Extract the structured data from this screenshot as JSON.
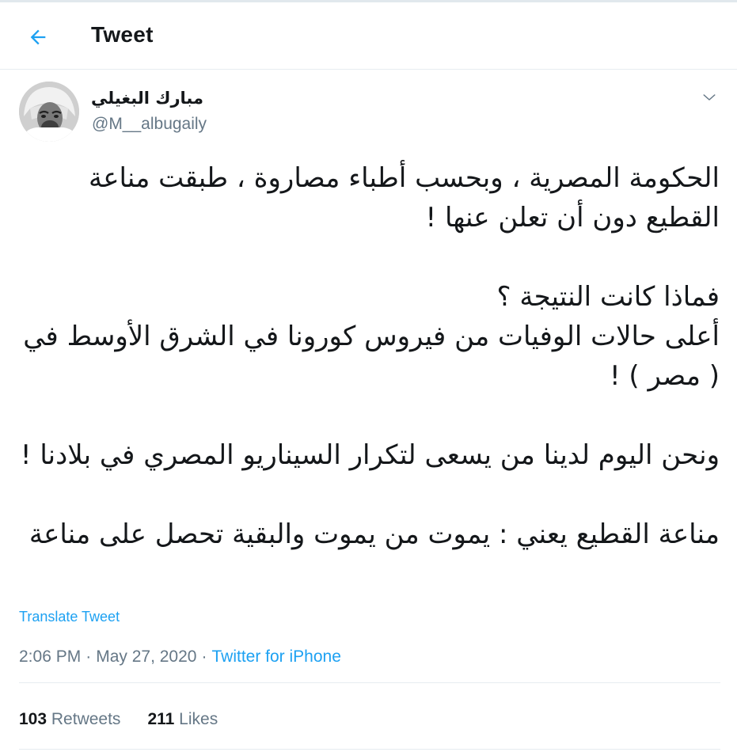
{
  "header": {
    "back_icon": "arrow-left-icon",
    "title": "Tweet",
    "accent_color": "#1da1f2"
  },
  "author": {
    "name": "مبارك البغيلي",
    "handle": "@M__albugaily",
    "avatar_icon": "user-avatar",
    "more_icon": "chevron-down-icon"
  },
  "tweet": {
    "paragraphs": [
      "الحكومة المصرية ، وبحسب أطباء مصاروة ، طبقت مناعة القطيع دون أن تعلن عنها !",
      "فماذا كانت النتيجة ؟\nأعلى حالات الوفيات من فيروس كورونا في الشرق الأوسط في ( مصر ) !",
      "ونحن اليوم لدينا من يسعى لتكرار السيناريو المصري في بلادنا !",
      "مناعة القطيع يعني : يموت من يموت والبقية تحصل على مناعة"
    ],
    "translate_label": "Translate Tweet"
  },
  "meta": {
    "time": "2:06 PM",
    "separator": "·",
    "date": "May 27, 2020",
    "source": "Twitter for iPhone"
  },
  "stats": {
    "retweets_count": "103",
    "retweets_label": "Retweets",
    "likes_count": "211",
    "likes_label": "Likes"
  }
}
